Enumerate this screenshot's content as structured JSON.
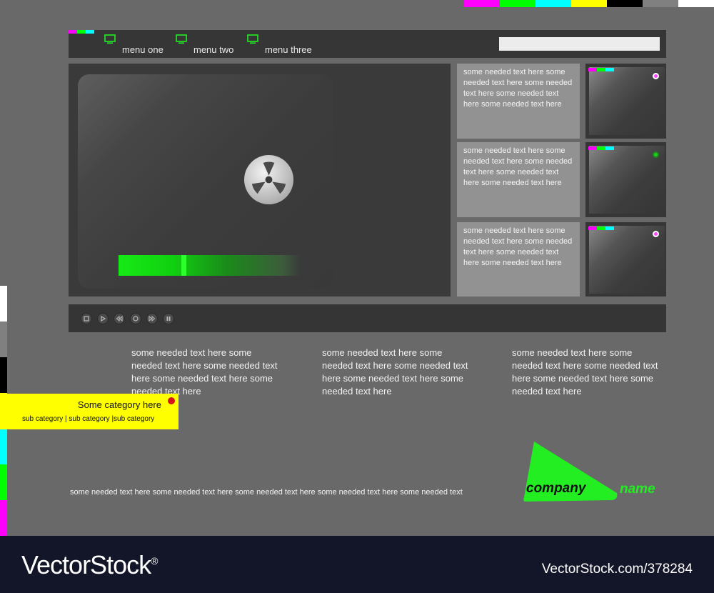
{
  "colors": {
    "background": "#696969",
    "panel": "#363636",
    "accent_green": "#22ee22",
    "magenta": "#ff00ff",
    "cyan": "#00ffff",
    "yellow": "#ffff00",
    "category_bg": "#ffff00",
    "watermark_bar": "#131528",
    "top_strip": [
      "#ff00ff",
      "#00ff00",
      "#00ffff",
      "#ffff00",
      "#000000",
      "#808080",
      "#ffffff"
    ],
    "left_strip": [
      "#ffffff",
      "#808080",
      "#000000",
      "#ffff00",
      "#00ffff",
      "#00ff00",
      "#ff00ff"
    ]
  },
  "nav": {
    "items": [
      {
        "label": "menu one",
        "icon": "monitor-icon"
      },
      {
        "label": "menu two",
        "icon": "monitor-icon"
      },
      {
        "label": "menu three",
        "icon": "monitor-icon"
      }
    ],
    "eye_icon": "eye-icon",
    "search_value": ""
  },
  "player": {
    "logo_icon": "film-reel-icon",
    "progress": 0.35,
    "controls": [
      "stop-icon",
      "play-icon",
      "rewind-icon",
      "record-icon",
      "fast-forward-icon",
      "pause-icon"
    ]
  },
  "side_boxes": [
    {
      "text": "some needed text here some needed text here some needed text here some needed text here some needed text here",
      "dot_color": "#ff44ff"
    },
    {
      "text": "some needed text here some needed text here some needed text here some needed text here some needed text here",
      "dot_color": "#22cc22"
    },
    {
      "text": "some needed text here some needed text here some needed text here some needed text here some needed text here",
      "dot_color": "#ff44ff"
    }
  ],
  "columns": [
    "some needed text here some needed text here some needed text here some needed text here some needed text here",
    "some needed text here some needed text here some needed text here some needed text here some needed text here",
    "some needed text here some needed text here some needed text here some needed text here some needed text here"
  ],
  "category": {
    "title": "Some category here",
    "sub": "sub category | sub category |sub category"
  },
  "footer_text": "some needed text here some needed text here some needed text here some needed text here some needed text",
  "logo": {
    "company": "company",
    "name": "name"
  },
  "watermark": {
    "brand": "VectorStock",
    "brand_mark": "®",
    "id": "VectorStock.com/378284"
  }
}
